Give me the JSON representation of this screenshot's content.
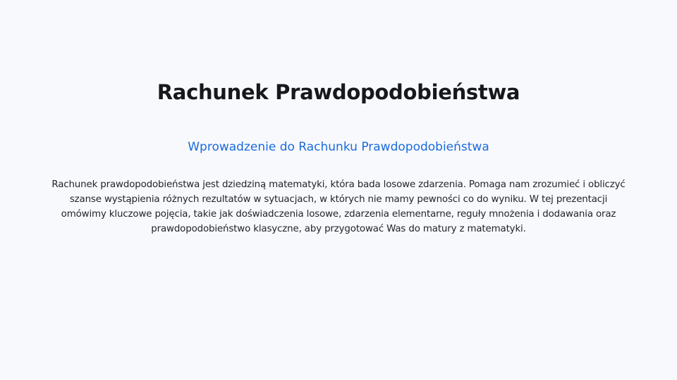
{
  "slide": {
    "title": "Rachunek Prawdopodobieństwa",
    "subtitle": "Wprowadzenie do Rachunku Prawdopodobieństwa",
    "body": "Rachunek prawdopodobieństwa jest dziedziną matematyki, która bada losowe zdarzenia. Pomaga nam zrozumieć i obliczyć szanse wystąpienia różnych rezultatów w sytuacjach, w których nie mamy pewności co do wyniku. W tej prezentacji omówimy kluczowe pojęcia, takie jak doświadczenia losowe, zdarzenia elementarne, reguły mnożenia i dodawania oraz prawdopodobieństwo klasyczne, aby przygotować Was do matury z matematyki."
  },
  "colors": {
    "background": "#f8f9fc",
    "title": "#17181d",
    "subtitle_accent": "#1a6bdc",
    "body_text": "#22232a"
  }
}
